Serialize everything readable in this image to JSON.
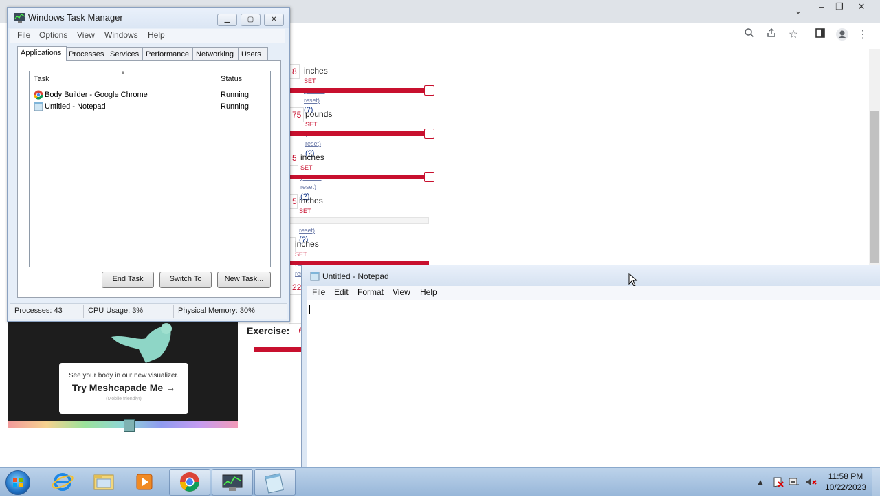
{
  "chrome": {
    "page": {
      "rows": [
        {
          "value": "8",
          "unit": "inches",
          "set": "SET",
          "reset": "(click to reset)",
          "help": "(?)",
          "fill_fraction": 1.0
        },
        {
          "value": "75",
          "unit": "pounds",
          "set": "SET",
          "reset": "(click to reset)",
          "help": "(?)",
          "fill_fraction": 1.0
        },
        {
          "value": "5",
          "unit": "inches",
          "set": "SET",
          "reset": "(click to reset)",
          "help": "(?)",
          "fill_fraction": 1.0
        },
        {
          "value": "5",
          "unit": "inches",
          "set": "SET",
          "reset": "(click to reset)",
          "help": "(?)",
          "fill_fraction": 0.0
        },
        {
          "value": "",
          "unit": "inches",
          "set": "SET",
          "reset": "(click to reset)",
          "help": "(?)",
          "fill_fraction": 1.0
        },
        {
          "value": "22"
        }
      ],
      "exercise": {
        "label": "Exercise:",
        "value": "6"
      },
      "visualizer": {
        "line1": "See your body in our new visualizer.",
        "line2": "Try Meshcapade Me",
        "arrow": "→",
        "line3": "(Mobile friendly!)"
      }
    },
    "toolbar_icons": [
      "zoom-icon",
      "share-icon",
      "star-icon",
      "sidebar-icon",
      "profile-icon",
      "menu-icon"
    ]
  },
  "taskmgr": {
    "title": "Windows Task Manager",
    "menu": [
      "File",
      "Options",
      "View",
      "Windows",
      "Help"
    ],
    "tabs": [
      "Applications",
      "Processes",
      "Services",
      "Performance",
      "Networking",
      "Users"
    ],
    "columns": {
      "task": "Task",
      "status": "Status"
    },
    "tasks": [
      {
        "name": "Body Builder - Google Chrome",
        "status": "Running",
        "icon": "chrome-icon"
      },
      {
        "name": "Untitled - Notepad",
        "status": "Running",
        "icon": "notepad-icon"
      }
    ],
    "buttons": {
      "end_task": "End Task",
      "switch_to": "Switch To",
      "new_task": "New Task..."
    },
    "status": {
      "processes": "Processes: 43",
      "cpu": "CPU Usage: 3%",
      "memory": "Physical Memory: 30%"
    }
  },
  "notepad": {
    "title": "Untitled - Notepad",
    "menu": [
      "File",
      "Edit",
      "Format",
      "View",
      "Help"
    ],
    "content": ""
  },
  "taskbar": {
    "apps": [
      "internet-explorer-icon",
      "file-explorer-icon",
      "media-player-icon",
      "chrome-icon",
      "task-manager-icon",
      "notepad-icon"
    ],
    "time": "11:58 PM",
    "date": "10/22/2023"
  },
  "colors": {
    "accent": "#c8102e",
    "link": "#1a3d8f"
  }
}
